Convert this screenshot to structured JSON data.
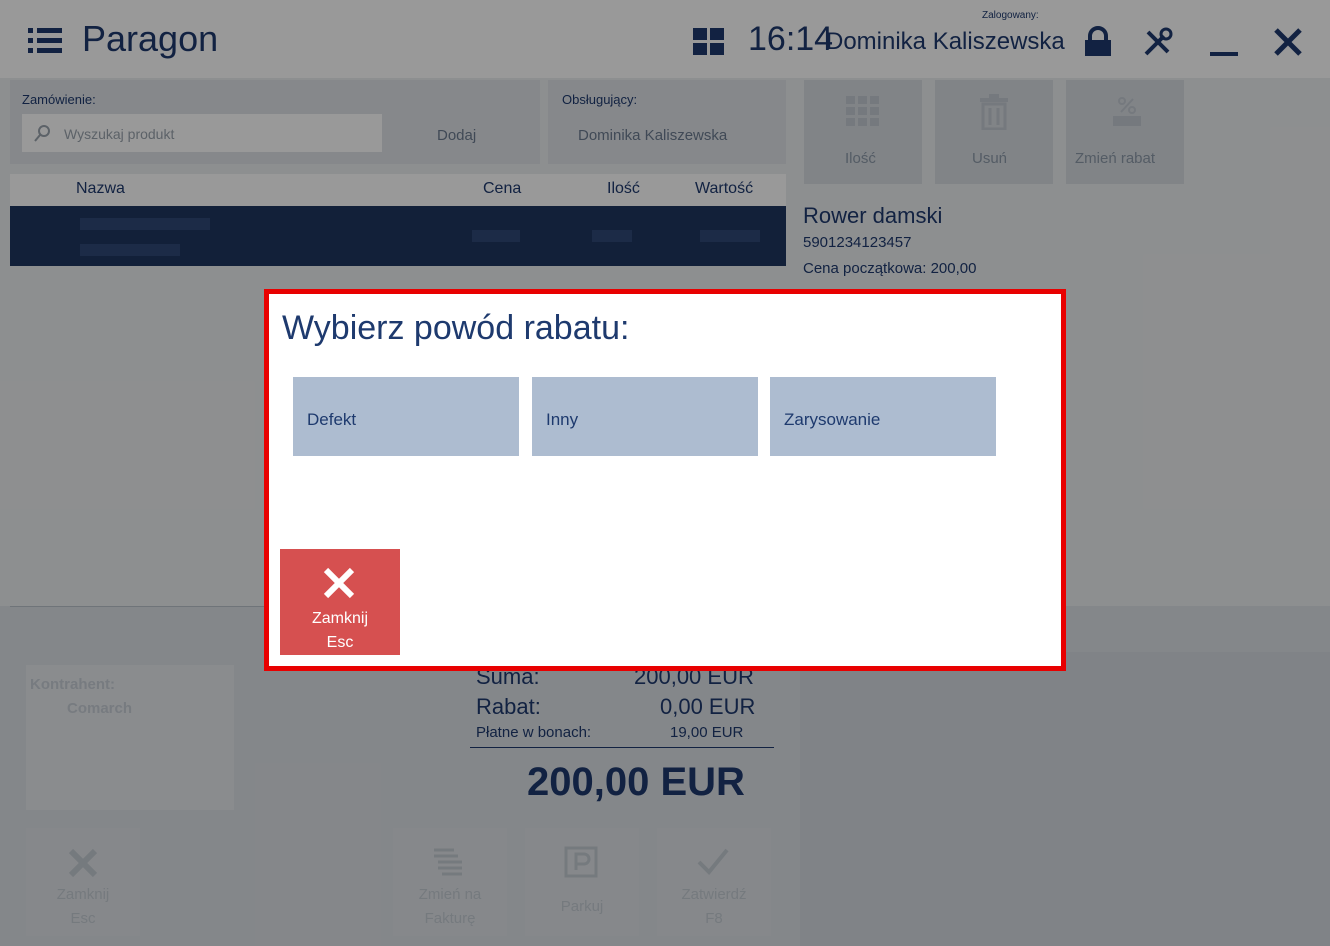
{
  "titlebar": {
    "title": "Paragon",
    "time": "16:14",
    "logged_label": "Zalogowany:",
    "user": "Dominika Kaliszewska",
    "icons": [
      "menu-icon",
      "grid-icon",
      "lock-icon",
      "tools-icon",
      "minimize-icon",
      "close-icon"
    ]
  },
  "order": {
    "label": "Zamówienie:",
    "placeholder": "Wyszukaj produkt",
    "add_label": "Dodaj",
    "served_label": "Obsługujący:",
    "served_value": "Dominika Kaliszewska"
  },
  "actions": [
    {
      "label": "Ilość",
      "icon": "keypad-icon"
    },
    {
      "label": "Usuń",
      "icon": "trash-icon"
    },
    {
      "label": "Zmień rabat",
      "icon": "percent-off-icon"
    }
  ],
  "table": {
    "columns": [
      "Nazwa",
      "Cena",
      "Ilość",
      "Wartość"
    ]
  },
  "product": {
    "name": "Rower damski",
    "ean": "5901234123457",
    "initial_price": "Cena początkowa: 200,00"
  },
  "summary": {
    "client_label": "Kontrahent:",
    "client_value": "Comarch",
    "sum_label": "Suma:",
    "sum_value": "200,00 EUR",
    "discount_label": "Rabat:",
    "discount_value": "0,00 EUR",
    "vouchers_label": "Płatne w bonach:",
    "vouchers_value": "19,00 EUR",
    "total": "200,00 EUR"
  },
  "bottom_buttons": [
    {
      "label": "Zamknij",
      "sub": "Esc",
      "icon": "close-icon"
    },
    {
      "label": "Zmień na",
      "sub": "Fakturę",
      "icon": "invoice-icon"
    },
    {
      "label": "Parkuj",
      "sub": "",
      "icon": "parking-icon"
    },
    {
      "label": "Zatwierdź",
      "sub": "F8",
      "icon": "check-icon"
    }
  ],
  "dialog": {
    "title": "Wybierz powód rabatu:",
    "options": [
      "Defekt",
      "Inny",
      "Zarysowanie"
    ],
    "close_label": "Zamknij",
    "close_key": "Esc"
  },
  "colors": {
    "primary": "#1e3a6e",
    "option_bg": "#adbcd0",
    "close_bg": "#d65050",
    "highlight_border": "#e80000"
  }
}
